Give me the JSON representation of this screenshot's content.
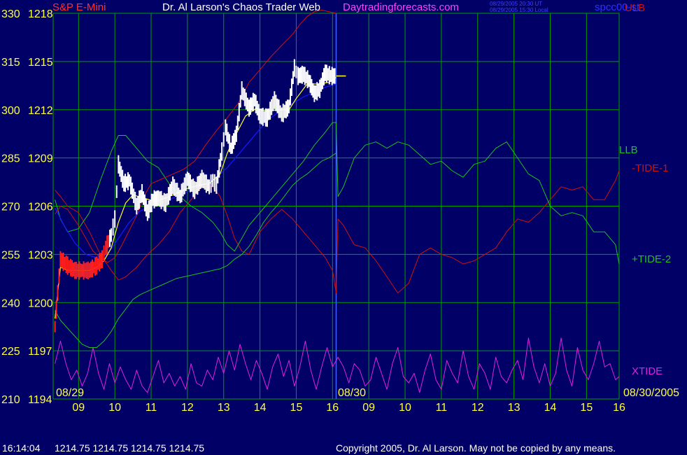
{
  "header": {
    "instrument": "S&P E-Mini",
    "title": "Dr. Al Larson's Chaos Trader Web",
    "site": "Daytradingforecasts.com",
    "ut_time": "08/29/2005 20:30 UT",
    "local_time": "08/29/2005 15:30 Local",
    "right_code": "spcc00-st"
  },
  "footer": {
    "time": "16:14:04",
    "quote": "1214.75 1214.75 1214.75 1214.75",
    "copyright": "Copyright 2005, Dr. Al Larson. May not be copied by any means."
  },
  "colors": {
    "background": "#000066",
    "grid": "#00a000",
    "price_up": "#ffffff",
    "price_down": "#ff2020",
    "red_band": "#d01010",
    "green_band": "#20c020",
    "blue_avg": "#1818ff",
    "yellow_avg": "#ffff20",
    "xtide": "#e020e0",
    "left_axis": "#ffff40",
    "session_line": "#4060ff"
  },
  "chart_data": {
    "type": "line",
    "left_axis_values": [
      "330",
      "315",
      "300",
      "285",
      "270",
      "255",
      "240",
      "225",
      "210"
    ],
    "price_axis_values": [
      "1218",
      "1215",
      "1212",
      "1209",
      "1206",
      "1203",
      "1200",
      "1197",
      "1194"
    ],
    "price_ylim": [
      1194,
      1218
    ],
    "left_ylim": [
      210,
      330
    ],
    "x_ticks": [
      "09",
      "10",
      "11",
      "12",
      "13",
      "14",
      "15",
      "16",
      "09",
      "10",
      "11",
      "12",
      "13",
      "14",
      "15",
      "16"
    ],
    "x_range_hours": [
      8.3,
      23.9
    ],
    "session_break_hour": 16.1,
    "date_labels": [
      "08/29",
      "08/30",
      "08/30/2005"
    ],
    "series_labels": [
      "ULB",
      "LLB",
      "-TIDE-1",
      "+TIDE-2",
      "XTIDE"
    ],
    "price_close": {
      "x": [
        8.35,
        8.5,
        8.7,
        8.9,
        9.1,
        9.3,
        9.5,
        9.65,
        9.75,
        9.9,
        10.0,
        10.1,
        10.25,
        10.4,
        10.6,
        10.75,
        10.9,
        11.05,
        11.2,
        11.4,
        11.6,
        11.8,
        12.0,
        12.2,
        12.4,
        12.6,
        12.7,
        12.8,
        12.95,
        13.05,
        13.2,
        13.35,
        13.5,
        13.7,
        13.85,
        14.0,
        14.2,
        14.4,
        14.6,
        14.8,
        14.95,
        15.05,
        15.2,
        15.35,
        15.5,
        15.65,
        15.8,
        15.95,
        16.1
      ],
      "y": [
        1198.5,
        1202.7,
        1202.3,
        1202.0,
        1202.0,
        1202.0,
        1202.3,
        1202.7,
        1203.4,
        1204.2,
        1205.2,
        1208.6,
        1207.4,
        1207.6,
        1206.0,
        1206.8,
        1205.6,
        1206.4,
        1206.5,
        1206.2,
        1207.3,
        1206.6,
        1207.7,
        1207.0,
        1207.7,
        1207.2,
        1207.6,
        1207.3,
        1209.4,
        1210.9,
        1209.6,
        1210.5,
        1213.2,
        1212.1,
        1212.6,
        1211.6,
        1211.5,
        1212.6,
        1211.7,
        1212.2,
        1214.6,
        1214.1,
        1214.2,
        1213.8,
        1213.0,
        1213.3,
        1214.3,
        1214.1,
        1214.1
      ]
    },
    "price_yellow_avg": {
      "x": [
        8.35,
        8.5,
        8.7,
        8.9,
        9.1,
        9.3,
        9.5,
        9.7,
        9.9,
        10.1,
        10.3,
        10.5,
        10.8,
        11.1,
        11.4,
        11.7,
        12.0,
        12.3,
        12.6,
        12.9,
        13.1,
        13.3,
        13.6,
        13.9,
        14.2,
        14.5,
        14.8,
        15.0,
        15.3,
        15.6,
        15.9,
        16.1
      ],
      "y": [
        1199.0,
        1202.2,
        1202.0,
        1202.0,
        1202.0,
        1202.0,
        1202.2,
        1202.6,
        1203.4,
        1205.0,
        1206.2,
        1206.7,
        1206.5,
        1206.3,
        1206.5,
        1206.8,
        1207.1,
        1207.3,
        1207.4,
        1208.0,
        1209.3,
        1210.3,
        1211.6,
        1212.1,
        1211.9,
        1212.0,
        1212.0,
        1212.7,
        1213.6,
        1213.6,
        1213.7,
        1214.0
      ]
    },
    "blue_avg": {
      "x": [
        8.35,
        8.6,
        8.9,
        9.2,
        9.5,
        9.8,
        10.1,
        10.4,
        10.7,
        11.0,
        11.3,
        11.6,
        11.9,
        12.2,
        12.5,
        12.8,
        13.1,
        13.4,
        13.7,
        14.0,
        14.3,
        14.6,
        14.9,
        15.2,
        15.5,
        15.8,
        16.1
      ],
      "y": [
        1205.9,
        1204.8,
        1203.7,
        1203.0,
        1202.8,
        1203.0,
        1204.0,
        1205.0,
        1205.7,
        1206.0,
        1206.2,
        1206.5,
        1206.8,
        1207.1,
        1207.4,
        1207.8,
        1208.4,
        1209.2,
        1210.0,
        1210.8,
        1211.5,
        1212.0,
        1212.4,
        1212.8,
        1213.1,
        1213.4,
        1213.6
      ]
    },
    "ulb": {
      "x": [
        8.35,
        8.5,
        8.7,
        9.0,
        9.2,
        9.4,
        9.6,
        9.8,
        10.0,
        10.2,
        10.4,
        10.6,
        10.8,
        11.0,
        11.3,
        11.6,
        11.9,
        12.2,
        12.5,
        12.8,
        13.1,
        13.4,
        13.7,
        14.0,
        14.3,
        14.6,
        14.9,
        15.1,
        15.3,
        15.5,
        15.7,
        15.9,
        16.1
      ],
      "y": [
        1205.5,
        1206.0,
        1205.8,
        1204.8,
        1204.0,
        1203.2,
        1202.8,
        1202.5,
        1202.8,
        1203.6,
        1204.5,
        1205.4,
        1206.6,
        1207.4,
        1207.7,
        1208.0,
        1208.3,
        1208.8,
        1209.8,
        1210.7,
        1211.5,
        1212.4,
        1213.7,
        1214.5,
        1215.3,
        1216.0,
        1216.7,
        1217.3,
        1217.8,
        1218.1,
        1218.2,
        1218.1,
        1218.0
      ]
    },
    "llb": {
      "x": [
        8.35,
        8.5,
        8.7,
        8.9,
        9.1,
        9.3,
        9.5,
        9.7,
        9.9,
        10.1,
        10.3,
        10.5,
        10.7,
        10.9,
        11.1,
        11.3,
        11.5,
        11.7,
        11.9,
        12.1,
        12.3,
        12.5,
        12.7,
        12.9,
        13.1,
        13.3,
        13.5,
        13.7,
        13.9,
        14.1,
        14.3,
        14.5,
        14.7,
        14.9,
        15.1,
        15.3,
        15.5,
        15.7,
        15.9,
        16.1
      ],
      "y": [
        1199.5,
        1198.9,
        1198.4,
        1197.9,
        1197.4,
        1197.2,
        1197.2,
        1197.6,
        1198.2,
        1199.0,
        1199.6,
        1200.2,
        1200.5,
        1200.7,
        1200.9,
        1201.1,
        1201.3,
        1201.5,
        1201.6,
        1201.7,
        1201.8,
        1201.9,
        1202.0,
        1202.1,
        1202.3,
        1202.7,
        1203.0,
        1203.5,
        1204.2,
        1205.0,
        1205.6,
        1206.1,
        1206.7,
        1207.3,
        1207.7,
        1208.0,
        1208.4,
        1208.8,
        1209.0,
        1209.3
      ]
    },
    "tide_green": {
      "x": [
        8.35,
        8.5,
        8.7,
        9.0,
        9.3,
        9.6,
        9.9,
        10.1,
        10.3,
        10.6,
        10.9,
        11.2,
        11.5,
        11.8,
        12.1,
        12.4,
        12.7,
        12.9,
        13.1,
        13.3,
        13.5,
        13.7,
        14.0,
        14.3,
        14.6,
        14.9,
        15.2,
        15.5,
        15.8,
        16.0,
        16.1,
        16.15,
        16.3,
        16.6,
        16.9,
        17.2,
        17.5,
        17.8,
        18.1,
        18.4,
        18.7,
        19.0,
        19.3,
        19.6,
        19.9,
        20.2,
        20.5,
        20.8,
        21.1,
        21.4,
        21.7,
        22.0,
        22.3,
        22.6,
        22.9,
        23.2,
        23.5,
        23.8,
        23.9
      ],
      "y": [
        272,
        266,
        262,
        263,
        268,
        278,
        287,
        292,
        292,
        288,
        284,
        282,
        277,
        273,
        270,
        268,
        265,
        262,
        258,
        256,
        260,
        264,
        268,
        272,
        276,
        280,
        284,
        289,
        293,
        296,
        296,
        273,
        276,
        285,
        289,
        290,
        288,
        290,
        289,
        286,
        283,
        284,
        281,
        279,
        283,
        284,
        288,
        290,
        285,
        280,
        278,
        270,
        267,
        268,
        267,
        262,
        262,
        258,
        252
      ]
    },
    "tide_red": {
      "x": [
        8.35,
        8.5,
        8.7,
        9.0,
        9.3,
        9.6,
        9.9,
        10.1,
        10.3,
        10.6,
        10.9,
        11.2,
        11.5,
        11.8,
        12.1,
        12.4,
        12.7,
        12.9,
        13.1,
        13.3,
        13.5,
        13.7,
        14.0,
        14.3,
        14.6,
        14.9,
        15.2,
        15.5,
        15.8,
        16.0,
        16.1,
        16.15,
        16.3,
        16.6,
        16.9,
        17.2,
        17.5,
        17.8,
        18.1,
        18.4,
        18.7,
        19.0,
        19.3,
        19.6,
        19.9,
        20.2,
        20.5,
        20.8,
        21.1,
        21.4,
        21.7,
        22.0,
        22.3,
        22.6,
        22.9,
        23.2,
        23.5,
        23.8,
        23.9
      ],
      "y": [
        275,
        273,
        270,
        268,
        262,
        255,
        250,
        247,
        248,
        251,
        255,
        258,
        262,
        268,
        272,
        276,
        276,
        273,
        267,
        260,
        256,
        255,
        262,
        266,
        269,
        266,
        262,
        258,
        254,
        250,
        243,
        266,
        264,
        258,
        257,
        253,
        248,
        243,
        246,
        255,
        257,
        255,
        254,
        252,
        253,
        255,
        257,
        262,
        266,
        265,
        268,
        272,
        276,
        275,
        276,
        272,
        272,
        278,
        281
      ]
    },
    "xtide": {
      "x": [
        8.35,
        8.5,
        8.65,
        8.8,
        8.95,
        9.1,
        9.25,
        9.4,
        9.55,
        9.7,
        9.85,
        10.0,
        10.15,
        10.3,
        10.45,
        10.6,
        10.75,
        10.9,
        11.05,
        11.2,
        11.35,
        11.5,
        11.65,
        11.8,
        11.95,
        12.1,
        12.25,
        12.4,
        12.55,
        12.7,
        12.85,
        13.0,
        13.15,
        13.3,
        13.45,
        13.6,
        13.75,
        13.9,
        14.05,
        14.2,
        14.35,
        14.5,
        14.65,
        14.8,
        14.95,
        15.1,
        15.25,
        15.4,
        15.55,
        15.7,
        15.85,
        16.0,
        16.15,
        16.3,
        16.45,
        16.6,
        16.75,
        16.9,
        17.05,
        17.2,
        17.35,
        17.5,
        17.65,
        17.8,
        17.95,
        18.1,
        18.25,
        18.4,
        18.55,
        18.7,
        18.85,
        19.0,
        19.15,
        19.3,
        19.45,
        19.6,
        19.75,
        19.9,
        20.05,
        20.2,
        20.35,
        20.5,
        20.65,
        20.8,
        20.95,
        21.1,
        21.25,
        21.4,
        21.55,
        21.7,
        21.85,
        22.0,
        22.15,
        22.3,
        22.45,
        22.6,
        22.75,
        22.9,
        23.05,
        23.2,
        23.35,
        23.5,
        23.65,
        23.8,
        23.9
      ],
      "y": [
        221,
        228,
        221,
        216,
        219,
        214,
        218,
        226,
        218,
        213,
        221,
        215,
        220,
        216,
        213,
        219,
        214,
        212,
        217,
        222,
        215,
        218,
        214,
        217,
        213,
        221,
        215,
        214,
        219,
        216,
        223,
        218,
        225,
        219,
        227,
        221,
        216,
        222,
        218,
        213,
        220,
        224,
        217,
        222,
        214,
        220,
        228,
        219,
        213,
        220,
        226,
        220,
        223,
        220,
        215,
        221,
        219,
        214,
        216,
        223,
        218,
        213,
        221,
        226,
        217,
        215,
        218,
        212,
        219,
        224,
        216,
        213,
        222,
        218,
        215,
        225,
        217,
        213,
        221,
        218,
        213,
        223,
        217,
        215,
        219,
        222,
        216,
        229,
        220,
        215,
        221,
        214,
        218,
        229,
        219,
        214,
        226,
        219,
        216,
        221,
        228,
        220,
        221,
        216,
        217
      ]
    }
  }
}
